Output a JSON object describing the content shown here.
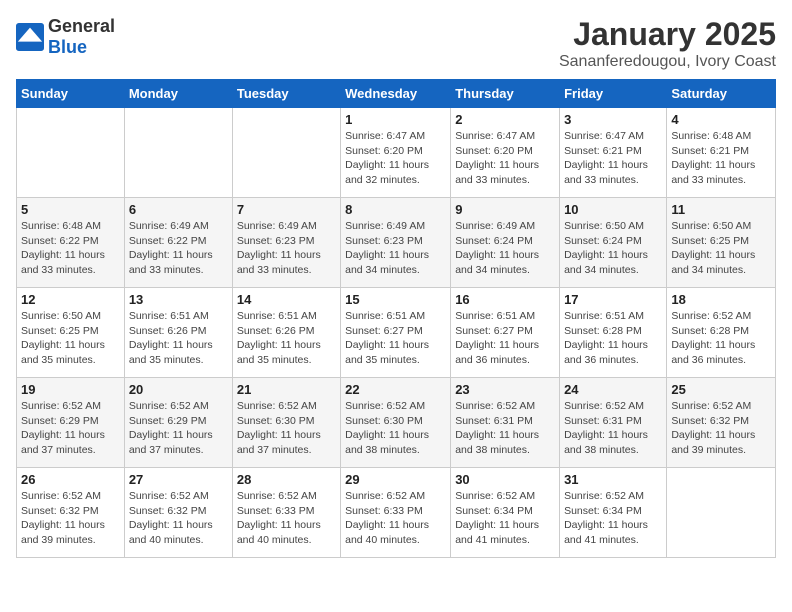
{
  "header": {
    "logo_general": "General",
    "logo_blue": "Blue",
    "month": "January 2025",
    "location": "Sananferedougou, Ivory Coast"
  },
  "days_of_week": [
    "Sunday",
    "Monday",
    "Tuesday",
    "Wednesday",
    "Thursday",
    "Friday",
    "Saturday"
  ],
  "weeks": [
    [
      {
        "day": "",
        "info": ""
      },
      {
        "day": "",
        "info": ""
      },
      {
        "day": "",
        "info": ""
      },
      {
        "day": "1",
        "info": "Sunrise: 6:47 AM\nSunset: 6:20 PM\nDaylight: 11 hours\nand 32 minutes."
      },
      {
        "day": "2",
        "info": "Sunrise: 6:47 AM\nSunset: 6:20 PM\nDaylight: 11 hours\nand 33 minutes."
      },
      {
        "day": "3",
        "info": "Sunrise: 6:47 AM\nSunset: 6:21 PM\nDaylight: 11 hours\nand 33 minutes."
      },
      {
        "day": "4",
        "info": "Sunrise: 6:48 AM\nSunset: 6:21 PM\nDaylight: 11 hours\nand 33 minutes."
      }
    ],
    [
      {
        "day": "5",
        "info": "Sunrise: 6:48 AM\nSunset: 6:22 PM\nDaylight: 11 hours\nand 33 minutes."
      },
      {
        "day": "6",
        "info": "Sunrise: 6:49 AM\nSunset: 6:22 PM\nDaylight: 11 hours\nand 33 minutes."
      },
      {
        "day": "7",
        "info": "Sunrise: 6:49 AM\nSunset: 6:23 PM\nDaylight: 11 hours\nand 33 minutes."
      },
      {
        "day": "8",
        "info": "Sunrise: 6:49 AM\nSunset: 6:23 PM\nDaylight: 11 hours\nand 34 minutes."
      },
      {
        "day": "9",
        "info": "Sunrise: 6:49 AM\nSunset: 6:24 PM\nDaylight: 11 hours\nand 34 minutes."
      },
      {
        "day": "10",
        "info": "Sunrise: 6:50 AM\nSunset: 6:24 PM\nDaylight: 11 hours\nand 34 minutes."
      },
      {
        "day": "11",
        "info": "Sunrise: 6:50 AM\nSunset: 6:25 PM\nDaylight: 11 hours\nand 34 minutes."
      }
    ],
    [
      {
        "day": "12",
        "info": "Sunrise: 6:50 AM\nSunset: 6:25 PM\nDaylight: 11 hours\nand 35 minutes."
      },
      {
        "day": "13",
        "info": "Sunrise: 6:51 AM\nSunset: 6:26 PM\nDaylight: 11 hours\nand 35 minutes."
      },
      {
        "day": "14",
        "info": "Sunrise: 6:51 AM\nSunset: 6:26 PM\nDaylight: 11 hours\nand 35 minutes."
      },
      {
        "day": "15",
        "info": "Sunrise: 6:51 AM\nSunset: 6:27 PM\nDaylight: 11 hours\nand 35 minutes."
      },
      {
        "day": "16",
        "info": "Sunrise: 6:51 AM\nSunset: 6:27 PM\nDaylight: 11 hours\nand 36 minutes."
      },
      {
        "day": "17",
        "info": "Sunrise: 6:51 AM\nSunset: 6:28 PM\nDaylight: 11 hours\nand 36 minutes."
      },
      {
        "day": "18",
        "info": "Sunrise: 6:52 AM\nSunset: 6:28 PM\nDaylight: 11 hours\nand 36 minutes."
      }
    ],
    [
      {
        "day": "19",
        "info": "Sunrise: 6:52 AM\nSunset: 6:29 PM\nDaylight: 11 hours\nand 37 minutes."
      },
      {
        "day": "20",
        "info": "Sunrise: 6:52 AM\nSunset: 6:29 PM\nDaylight: 11 hours\nand 37 minutes."
      },
      {
        "day": "21",
        "info": "Sunrise: 6:52 AM\nSunset: 6:30 PM\nDaylight: 11 hours\nand 37 minutes."
      },
      {
        "day": "22",
        "info": "Sunrise: 6:52 AM\nSunset: 6:30 PM\nDaylight: 11 hours\nand 38 minutes."
      },
      {
        "day": "23",
        "info": "Sunrise: 6:52 AM\nSunset: 6:31 PM\nDaylight: 11 hours\nand 38 minutes."
      },
      {
        "day": "24",
        "info": "Sunrise: 6:52 AM\nSunset: 6:31 PM\nDaylight: 11 hours\nand 38 minutes."
      },
      {
        "day": "25",
        "info": "Sunrise: 6:52 AM\nSunset: 6:32 PM\nDaylight: 11 hours\nand 39 minutes."
      }
    ],
    [
      {
        "day": "26",
        "info": "Sunrise: 6:52 AM\nSunset: 6:32 PM\nDaylight: 11 hours\nand 39 minutes."
      },
      {
        "day": "27",
        "info": "Sunrise: 6:52 AM\nSunset: 6:32 PM\nDaylight: 11 hours\nand 40 minutes."
      },
      {
        "day": "28",
        "info": "Sunrise: 6:52 AM\nSunset: 6:33 PM\nDaylight: 11 hours\nand 40 minutes."
      },
      {
        "day": "29",
        "info": "Sunrise: 6:52 AM\nSunset: 6:33 PM\nDaylight: 11 hours\nand 40 minutes."
      },
      {
        "day": "30",
        "info": "Sunrise: 6:52 AM\nSunset: 6:34 PM\nDaylight: 11 hours\nand 41 minutes."
      },
      {
        "day": "31",
        "info": "Sunrise: 6:52 AM\nSunset: 6:34 PM\nDaylight: 11 hours\nand 41 minutes."
      },
      {
        "day": "",
        "info": ""
      }
    ]
  ]
}
